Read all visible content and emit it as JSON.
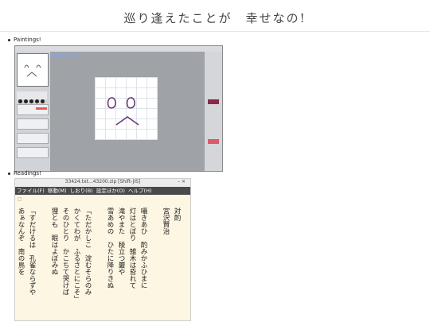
{
  "header": {
    "title": "巡り逢えたことが　幸せなの!"
  },
  "sections": {
    "paintings": "Paintings!",
    "readings": "Readings!"
  },
  "reader": {
    "window_title": "33424.txt...43200.zip [Shift-JIS]",
    "window_controls": "–   ×",
    "menu": [
      "ファイル(F)",
      "移動(M)",
      "しおり(B)",
      "設定ほか(O)",
      "ヘルプ(H)"
    ],
    "page_marker": "□",
    "columns": [
      "対酌",
      "宮沢賢治",
      "",
      "囁きあひ　酌みかふひまに",
      "灯はとぼり　雑木は昏れて",
      "滝やまた　稜立つ巖や",
      "雪あめの　ひたに降りきぬ",
      "",
      "「ただかしこ　淀むそらのみ",
      "かくてわが　ふるさとにこそ」",
      "そのひとり　かこちて哭けば",
      "狸とも　眼はよぼみぬ",
      "",
      "「すだけるは　孔雀ならずや",
      "あぁなんぞ　南の鳥を"
    ]
  },
  "colors": {
    "page_bg": "#ffffff",
    "reader_bg": "#fdf6e3",
    "menu_bg": "#4a4a4a",
    "stroke": "#6b3a78"
  }
}
